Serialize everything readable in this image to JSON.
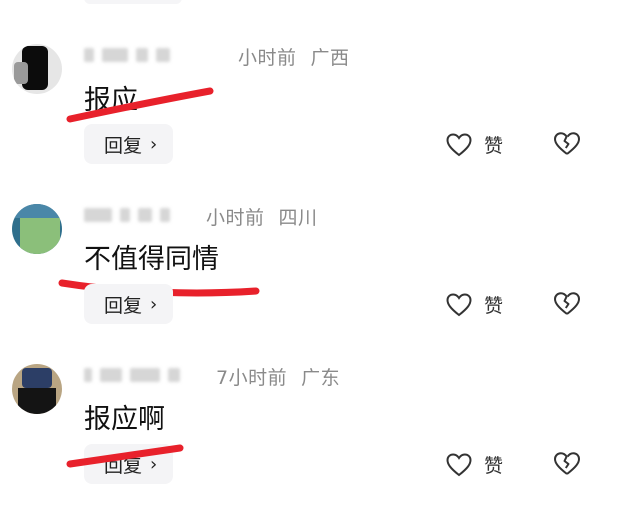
{
  "comments": [
    {
      "time": "小时前",
      "location": "广西",
      "text": "报应",
      "reply_label": "回复",
      "like_label": "赞"
    },
    {
      "time": "小时前",
      "location": "四川",
      "text": "不值得同情",
      "reply_label": "回复",
      "like_label": "赞"
    },
    {
      "time": "7小时前",
      "location": "广东",
      "text": "报应啊",
      "reply_label": "回复",
      "like_label": "赞"
    }
  ],
  "colors": {
    "underline": "#e8212b",
    "meta": "#8a8a8a",
    "reply_bg": "#f4f4f6"
  },
  "icons": {
    "reply": "chevron-right-icon",
    "like": "heart-outline-icon",
    "dislike": "broken-heart-icon"
  }
}
